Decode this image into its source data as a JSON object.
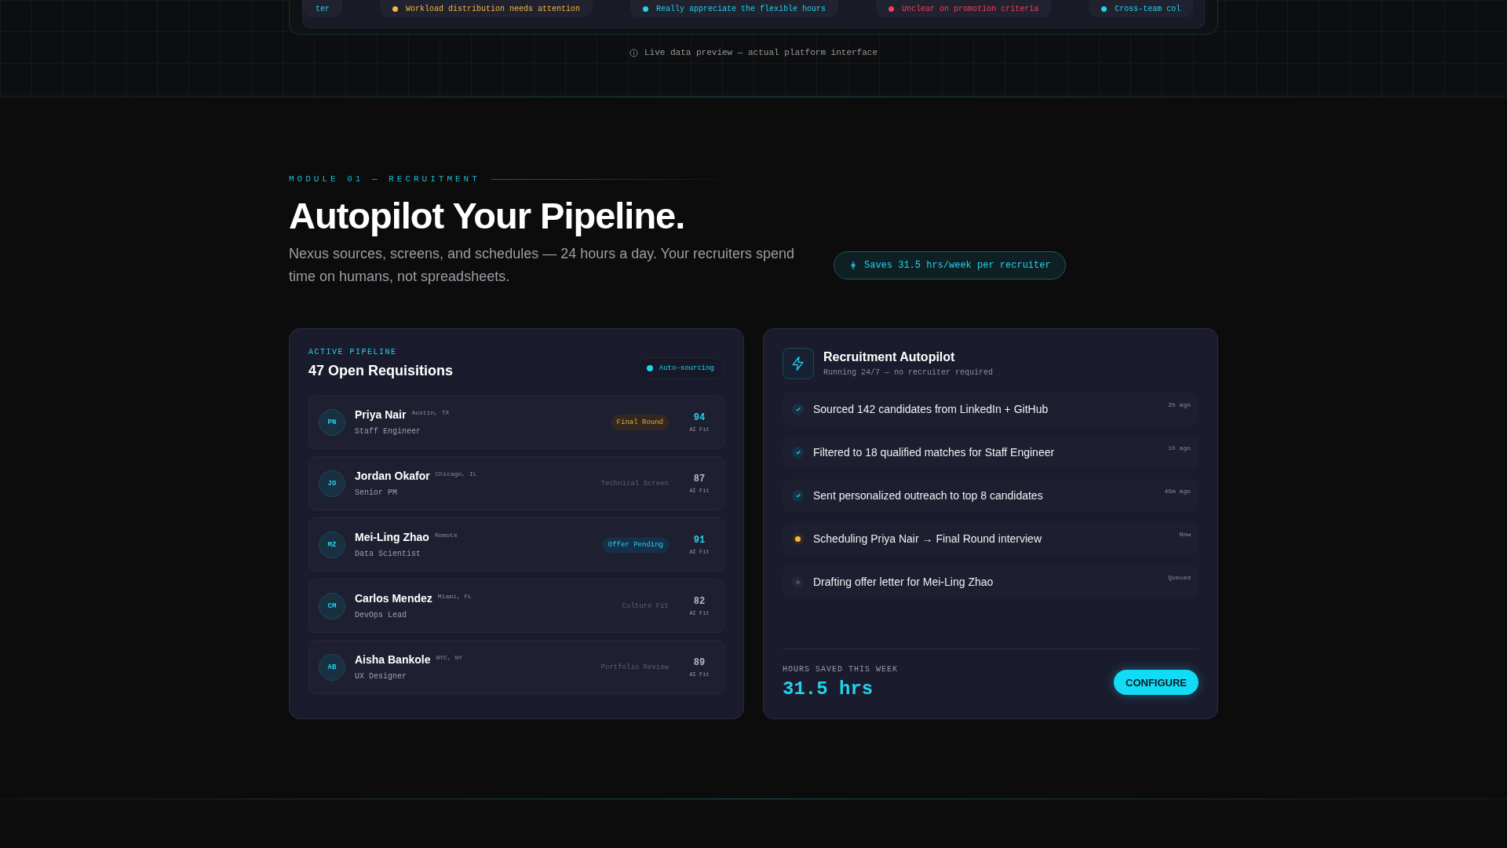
{
  "preview": {
    "chips": [
      {
        "text": "ter"
      },
      {
        "text": "Workload distribution needs attention",
        "color": "#f5b942"
      },
      {
        "text": "Really appreciate the flexible hours",
        "color": "#22d3ee"
      },
      {
        "text": "Unclear on promotion criteria",
        "color": "#f43f5e"
      },
      {
        "text": "Cross-team col",
        "color": "#22d3ee"
      }
    ],
    "note": "Live data preview — actual platform interface"
  },
  "section": {
    "eyebrow": "MODULE 01 — RECRUITMENT",
    "title": "Autopilot Your Pipeline.",
    "description": "Nexus sources, screens, and schedules — 24 hours a day. Your recruiters spend time on humans, not spreadsheets.",
    "badge": "Saves 31.5 hrs/week per recruiter"
  },
  "pipeline": {
    "eyebrow": "ACTIVE PIPELINE",
    "title": "47 Open Requisitions",
    "status": "Auto-sourcing",
    "candidates": [
      {
        "initials": "PN",
        "name": "Priya Nair",
        "location": "Austin, TX",
        "role": "Staff Engineer",
        "stage": "Final Round",
        "kind": "warning",
        "score": "94",
        "score_label": "AI Fit",
        "highlight": true
      },
      {
        "initials": "JO",
        "name": "Jordan Okafor",
        "location": "Chicago, IL",
        "role": "Senior PM",
        "stage": "Technical Screen",
        "kind": "plain",
        "score": "87",
        "score_label": "AI Fit",
        "highlight": false
      },
      {
        "initials": "MZ",
        "name": "Mei-Ling Zhao",
        "location": "Remote",
        "role": "Data Scientist",
        "stage": "Offer Pending",
        "kind": "info",
        "score": "91",
        "score_label": "AI Fit",
        "highlight": true
      },
      {
        "initials": "CM",
        "name": "Carlos Mendez",
        "location": "Miami, FL",
        "role": "DevOps Lead",
        "stage": "Culture Fit",
        "kind": "plain",
        "score": "82",
        "score_label": "AI Fit",
        "highlight": false
      },
      {
        "initials": "AB",
        "name": "Aisha Bankole",
        "location": "NYC, NY",
        "role": "UX Designer",
        "stage": "Portfolio Review",
        "kind": "plain",
        "score": "89",
        "score_label": "AI Fit",
        "highlight": false
      }
    ]
  },
  "autopilot": {
    "title": "Recruitment Autopilot",
    "subtitle": "Running 24/7 — no recruiter required",
    "tasks": [
      {
        "text": "Sourced 142 candidates from LinkedIn + GitHub",
        "time": "2h ago",
        "kind": "done"
      },
      {
        "text": "Filtered to 18 qualified matches for Staff Engineer",
        "time": "1h ago",
        "kind": "done"
      },
      {
        "text": "Sent personalized outreach to top 8 candidates",
        "time": "45m ago",
        "kind": "done"
      },
      {
        "text": "Scheduling Priya Nair → Final Round interview",
        "time": "Now",
        "kind": "active"
      },
      {
        "text": "Drafting offer letter for Mei-Ling Zhao",
        "time": "Queued",
        "kind": "queued"
      }
    ],
    "stat_label": "HOURS SAVED THIS WEEK",
    "stat_value": "31.5 hrs",
    "button": "CONFIGURE"
  }
}
